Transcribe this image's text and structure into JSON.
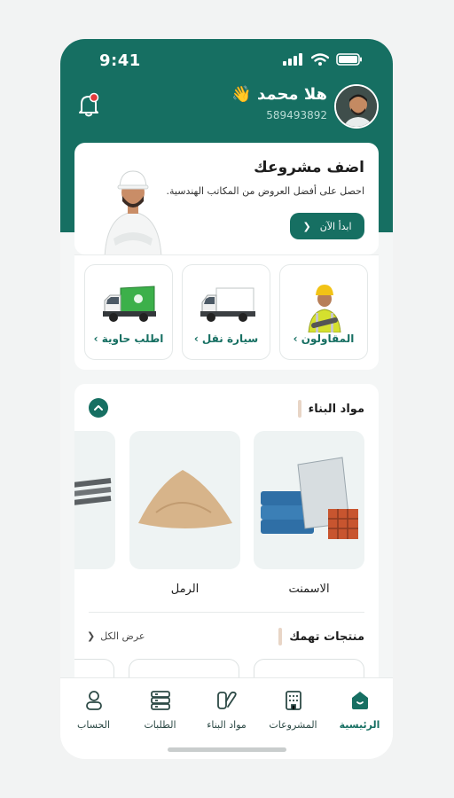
{
  "status_bar": {
    "time": "9:41"
  },
  "user": {
    "greeting": "هلا محمد 👋",
    "phone": "589493892"
  },
  "promo": {
    "title": "اضف مشروعك",
    "subtitle": "احصل على أفضل العروض من المكاتب الهندسية.",
    "button_label": "ابدأ الآن"
  },
  "services": [
    {
      "label": "المقاولون ›"
    },
    {
      "label": "سيارة نقل ›"
    },
    {
      "label": "اطلب حاوية ›"
    }
  ],
  "materials": {
    "title": "مواد البناء",
    "items": [
      {
        "name": "الاسمنت"
      },
      {
        "name": "الرمل"
      }
    ]
  },
  "products": {
    "title": "منتجات تهمك",
    "view_all": "عرض الكل"
  },
  "nav": [
    {
      "label": "الرئيسية",
      "icon": "home-icon",
      "active": true
    },
    {
      "label": "المشروعات",
      "icon": "building-icon"
    },
    {
      "label": "مواد البناء",
      "icon": "materials-icon"
    },
    {
      "label": "الطلبات",
      "icon": "orders-icon"
    },
    {
      "label": "الحساب",
      "icon": "user-icon"
    }
  ],
  "colors": {
    "brand": "#166f62",
    "accent_bar": "#e8d5c6",
    "notification_dot": "#e23b3b"
  }
}
